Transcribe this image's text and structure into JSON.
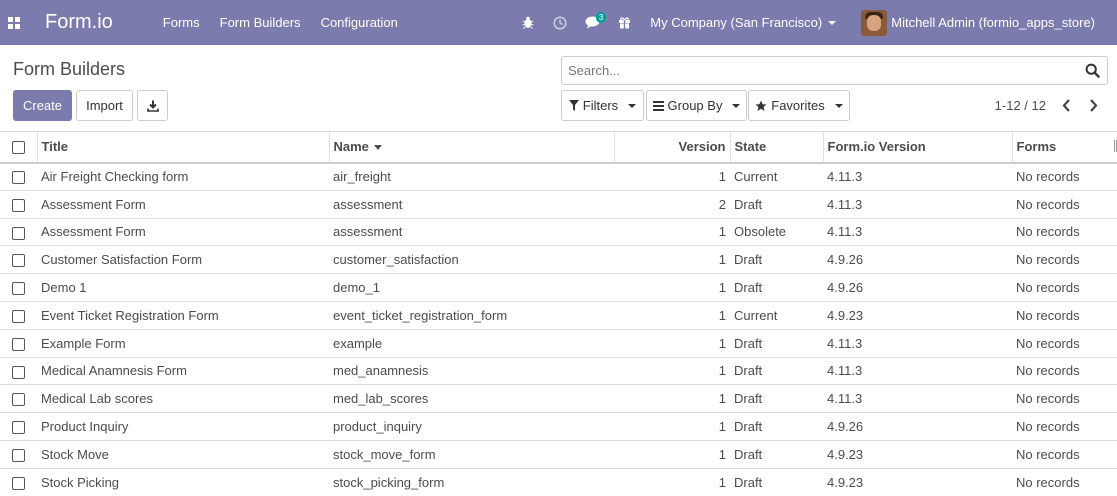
{
  "navbar": {
    "brand": "Form.io",
    "menu": [
      "Forms",
      "Form Builders",
      "Configuration"
    ],
    "messages_count": "3",
    "company": "My Company (San Francisco)",
    "user": "Mitchell Admin (formio_apps_store)",
    "icons": [
      "apps-icon",
      "bug-icon",
      "clock-icon",
      "chat-icon",
      "gift-icon"
    ],
    "bg_color": "#7c7bad"
  },
  "control_panel": {
    "title": "Form Builders",
    "search_placeholder": "Search...",
    "create_label": "Create",
    "import_label": "Import",
    "filters_label": "Filters",
    "group_by_label": "Group By",
    "favorites_label": "Favorites",
    "pager": "1-12 / 12"
  },
  "table": {
    "headers": {
      "title": "Title",
      "name": "Name",
      "version": "Version",
      "state": "State",
      "formio_version": "Form.io Version",
      "forms": "Forms"
    },
    "rows": [
      {
        "title": "Air Freight Checking form",
        "name": "air_freight",
        "version": "1",
        "state": "Current",
        "formio_version": "4.11.3",
        "forms": "No records"
      },
      {
        "title": "Assessment Form",
        "name": "assessment",
        "version": "2",
        "state": "Draft",
        "formio_version": "4.11.3",
        "forms": "No records"
      },
      {
        "title": "Assessment Form",
        "name": "assessment",
        "version": "1",
        "state": "Obsolete",
        "formio_version": "4.11.3",
        "forms": "No records"
      },
      {
        "title": "Customer Satisfaction Form",
        "name": "customer_satisfaction",
        "version": "1",
        "state": "Draft",
        "formio_version": "4.9.26",
        "forms": "No records"
      },
      {
        "title": "Demo 1",
        "name": "demo_1",
        "version": "1",
        "state": "Draft",
        "formio_version": "4.9.26",
        "forms": "No records"
      },
      {
        "title": "Event Ticket Registration Form",
        "name": "event_ticket_registration_form",
        "version": "1",
        "state": "Current",
        "formio_version": "4.9.23",
        "forms": "No records"
      },
      {
        "title": "Example Form",
        "name": "example",
        "version": "1",
        "state": "Draft",
        "formio_version": "4.11.3",
        "forms": "No records"
      },
      {
        "title": "Medical Anamnesis Form",
        "name": "med_anamnesis",
        "version": "1",
        "state": "Draft",
        "formio_version": "4.11.3",
        "forms": "No records"
      },
      {
        "title": "Medical Lab scores",
        "name": "med_lab_scores",
        "version": "1",
        "state": "Draft",
        "formio_version": "4.11.3",
        "forms": "No records"
      },
      {
        "title": "Product Inquiry",
        "name": "product_inquiry",
        "version": "1",
        "state": "Draft",
        "formio_version": "4.9.26",
        "forms": "No records"
      },
      {
        "title": "Stock Move",
        "name": "stock_move_form",
        "version": "1",
        "state": "Draft",
        "formio_version": "4.9.23",
        "forms": "No records"
      },
      {
        "title": "Stock Picking",
        "name": "stock_picking_form",
        "version": "1",
        "state": "Draft",
        "formio_version": "4.9.23",
        "forms": "No records"
      }
    ]
  }
}
